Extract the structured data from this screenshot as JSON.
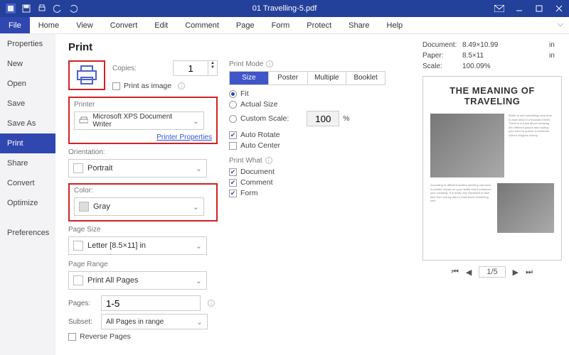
{
  "titlebar": {
    "title": "01 Travelling-5.pdf"
  },
  "menubar": {
    "items": [
      "File",
      "Home",
      "View",
      "Convert",
      "Edit",
      "Comment",
      "Page",
      "Form",
      "Protect",
      "Share",
      "Help"
    ],
    "active": 0
  },
  "sidebar": {
    "items": [
      "Properties",
      "New",
      "Open",
      "Save",
      "Save As",
      "Print",
      "Share",
      "Convert",
      "Optimize",
      "",
      "Preferences"
    ],
    "active": 5
  },
  "page_title": "Print",
  "copies": {
    "label": "Copies:",
    "value": "1"
  },
  "print_as_image": {
    "label": "Print as image",
    "checked": false
  },
  "printer": {
    "section_label": "Printer",
    "value": "Microsoft XPS Document Writer",
    "properties_link": "Printer Properties"
  },
  "orientation": {
    "label": "Orientation:",
    "value": "Portrait"
  },
  "color": {
    "label": "Color:",
    "value": "Gray"
  },
  "page_size": {
    "label": "Page Size",
    "value": "Letter [8.5×11] in"
  },
  "page_range": {
    "label": "Page Range",
    "value": "Print All Pages"
  },
  "pages": {
    "label": "Pages:",
    "value": "1-5"
  },
  "subset": {
    "label": "Subset:",
    "value": "All Pages in range"
  },
  "reverse_pages": {
    "label": "Reverse Pages",
    "checked": false
  },
  "print_mode": {
    "label": "Print Mode",
    "tabs": [
      "Size",
      "Poster",
      "Multiple",
      "Booklet"
    ],
    "active": 0,
    "fit": "Fit",
    "actual": "Actual Size",
    "custom": "Custom Scale:",
    "custom_value": "100",
    "custom_unit": "%",
    "auto_rotate": "Auto Rotate",
    "auto_center": "Auto Center"
  },
  "print_what": {
    "label": "Print What",
    "document": "Document",
    "comment": "Comment",
    "form": "Form"
  },
  "docmeta": {
    "document_label": "Document:",
    "document_value": "8.49×10.99",
    "paper_label": "Paper:",
    "paper_value": "8.5×11",
    "unit": "in",
    "scale_label": "Scale:",
    "scale_value": "100.09%"
  },
  "preview": {
    "title": "THE MEANING OF TRAVELING",
    "page_indicator": "1/5"
  }
}
